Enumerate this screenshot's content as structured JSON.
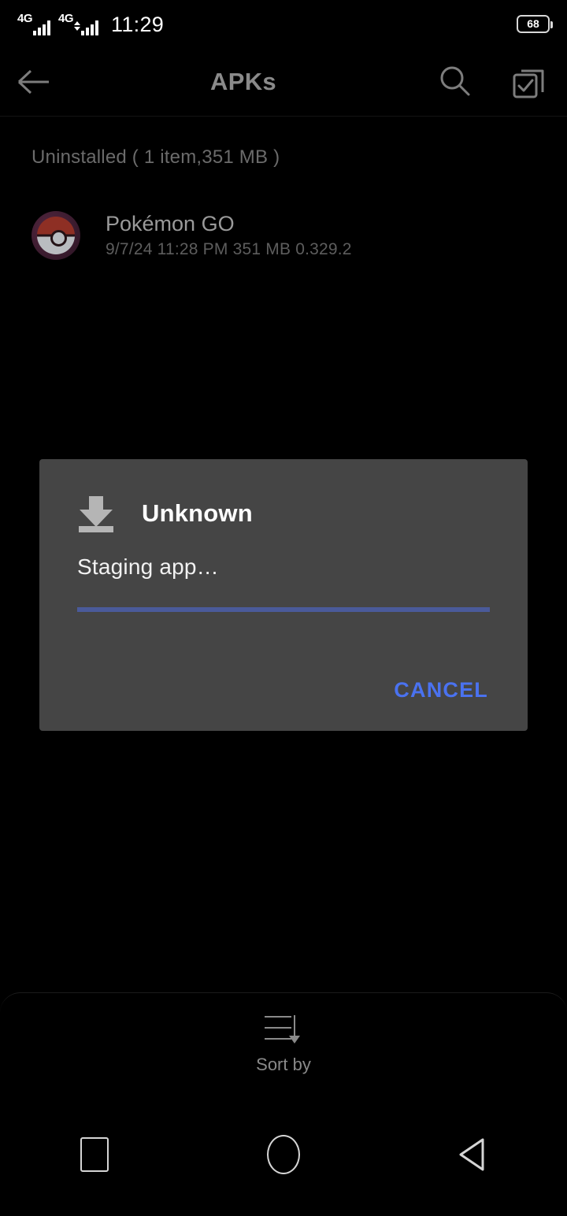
{
  "status_bar": {
    "network_label": "4G",
    "network_label_2": "4G",
    "time": "11:29",
    "battery_level": "68"
  },
  "app_bar": {
    "title": "APKs",
    "back_icon": "back-arrow-icon",
    "search_icon": "search-icon",
    "select_all_icon": "select-all-icon"
  },
  "list": {
    "section_header": "Uninstalled ( 1 item,351 MB )",
    "items": [
      {
        "name": "Pokémon GO",
        "subtitle": "9/7/24 11:28 PM  351 MB  0.329.2",
        "icon": "pokeball-icon"
      }
    ]
  },
  "dialog": {
    "icon": "download-icon",
    "title": "Unknown",
    "message": "Staging app…",
    "progress_percent": 100,
    "progress_color": "#4a5a9a",
    "cancel_label": "CANCEL",
    "cancel_color": "#4a72f0",
    "background_color": "#454545"
  },
  "bottom_bar": {
    "sort_label": "Sort by",
    "sort_icon": "sort-descending-icon"
  },
  "nav_bar": {
    "recents_icon": "square-recents-icon",
    "home_icon": "circle-home-icon",
    "back_icon": "triangle-back-icon"
  }
}
